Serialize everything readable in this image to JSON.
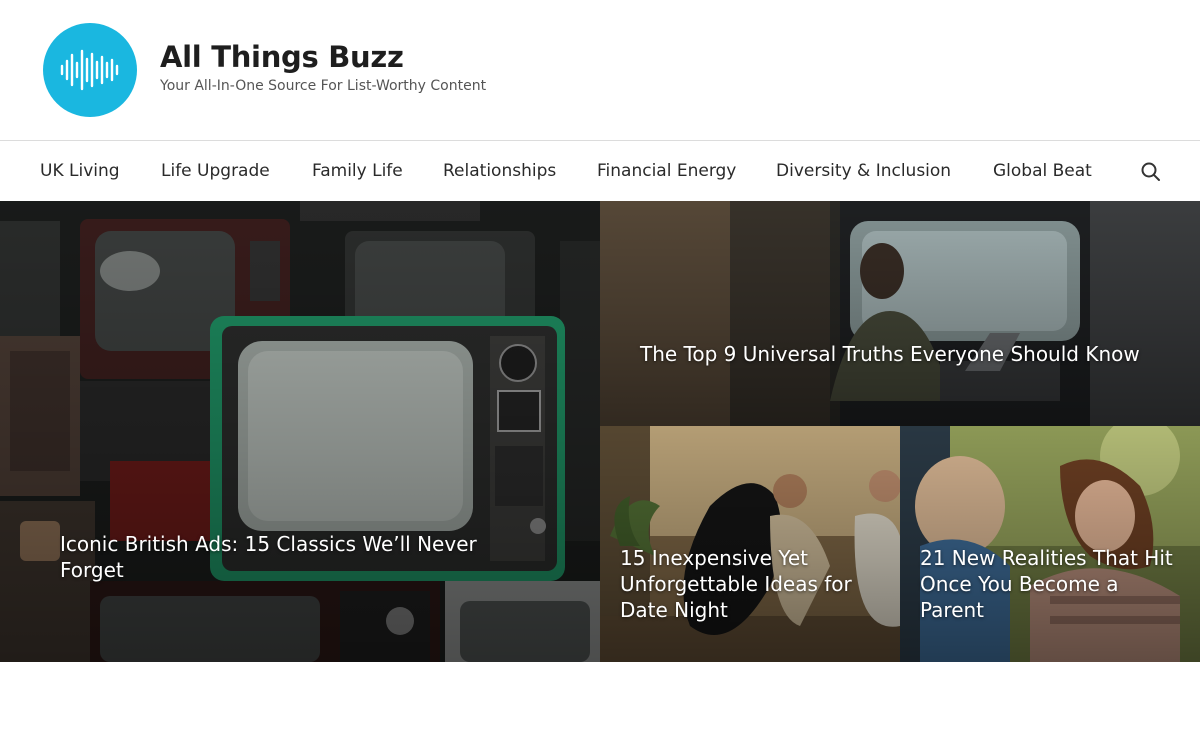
{
  "site": {
    "title": "All Things Buzz",
    "tagline": "Your All-In-One Source For List-Worthy Content",
    "logo_icon": "sound-wave-icon",
    "brand_color": "#1ab7e0"
  },
  "nav": {
    "items": [
      "UK Living",
      "Life Upgrade",
      "Family Life",
      "Relationships",
      "Financial Energy",
      "Diversity & Inclusion",
      "Global Beat"
    ],
    "search_icon": "search-icon"
  },
  "features": [
    {
      "title": "Iconic British Ads: 15 Classics We’ll Never Forget"
    },
    {
      "title": "The Top 9 Universal Truths Everyone Should Know"
    },
    {
      "title": "15 Inexpensive Yet Unforgettable Ideas for Date Night"
    },
    {
      "title": "21 New Realities That Hit Once You Become a Parent"
    }
  ]
}
